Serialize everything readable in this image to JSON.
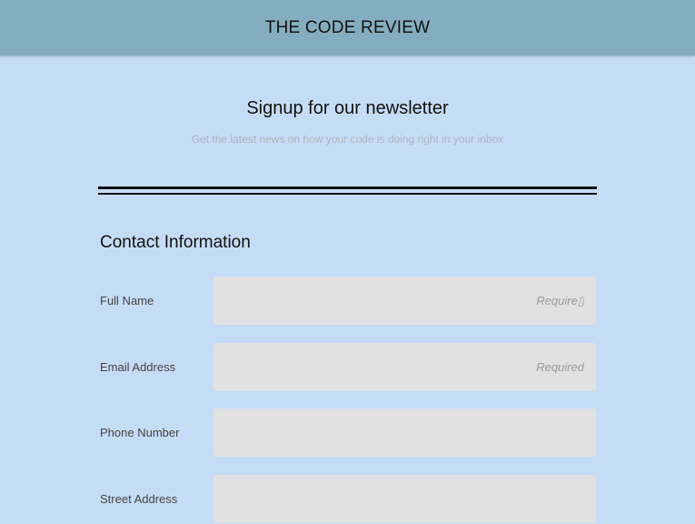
{
  "header": {
    "title": "THE CODE REVIEW"
  },
  "intro": {
    "heading": "Signup for our newsletter",
    "subheading": "Get the latest news on how your code is doing right in your inbox"
  },
  "contact": {
    "section_title": "Contact Information",
    "fields": [
      {
        "label": "Full Name",
        "value": "",
        "placeholder": "Require▯"
      },
      {
        "label": "Email Address",
        "value": "",
        "placeholder": "Required"
      },
      {
        "label": "Phone Number",
        "value": "",
        "placeholder": ""
      },
      {
        "label": "Street Address",
        "value": "",
        "placeholder": ""
      }
    ]
  },
  "colors": {
    "header_bg": "#84aebf",
    "page_bg": "#c5dcf6",
    "input_bg": "#e1e1e1",
    "divider": "#0d0d0d"
  }
}
